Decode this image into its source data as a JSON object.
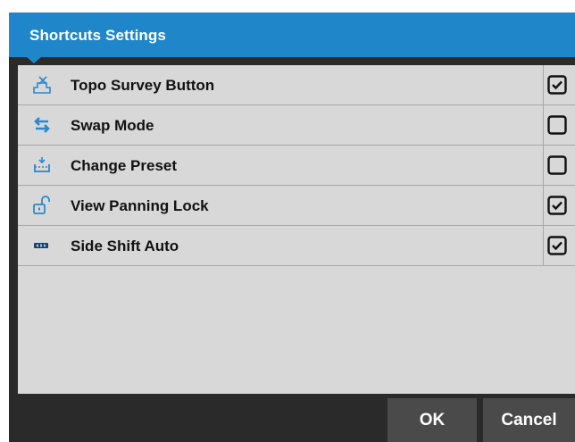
{
  "dialog": {
    "title": "Shortcuts Settings",
    "accent_color": "#1f86c9"
  },
  "shortcuts": [
    {
      "label": "Topo Survey Button",
      "icon": "topo-survey-icon",
      "checked": true
    },
    {
      "label": "Swap Mode",
      "icon": "swap-arrows-icon",
      "checked": false
    },
    {
      "label": "Change Preset",
      "icon": "preset-icon",
      "checked": false
    },
    {
      "label": "View Panning Lock",
      "icon": "padlock-open-icon",
      "checked": true
    },
    {
      "label": "Side Shift Auto",
      "icon": "side-shift-icon",
      "checked": true
    }
  ],
  "buttons": {
    "ok": "OK",
    "cancel": "Cancel"
  }
}
